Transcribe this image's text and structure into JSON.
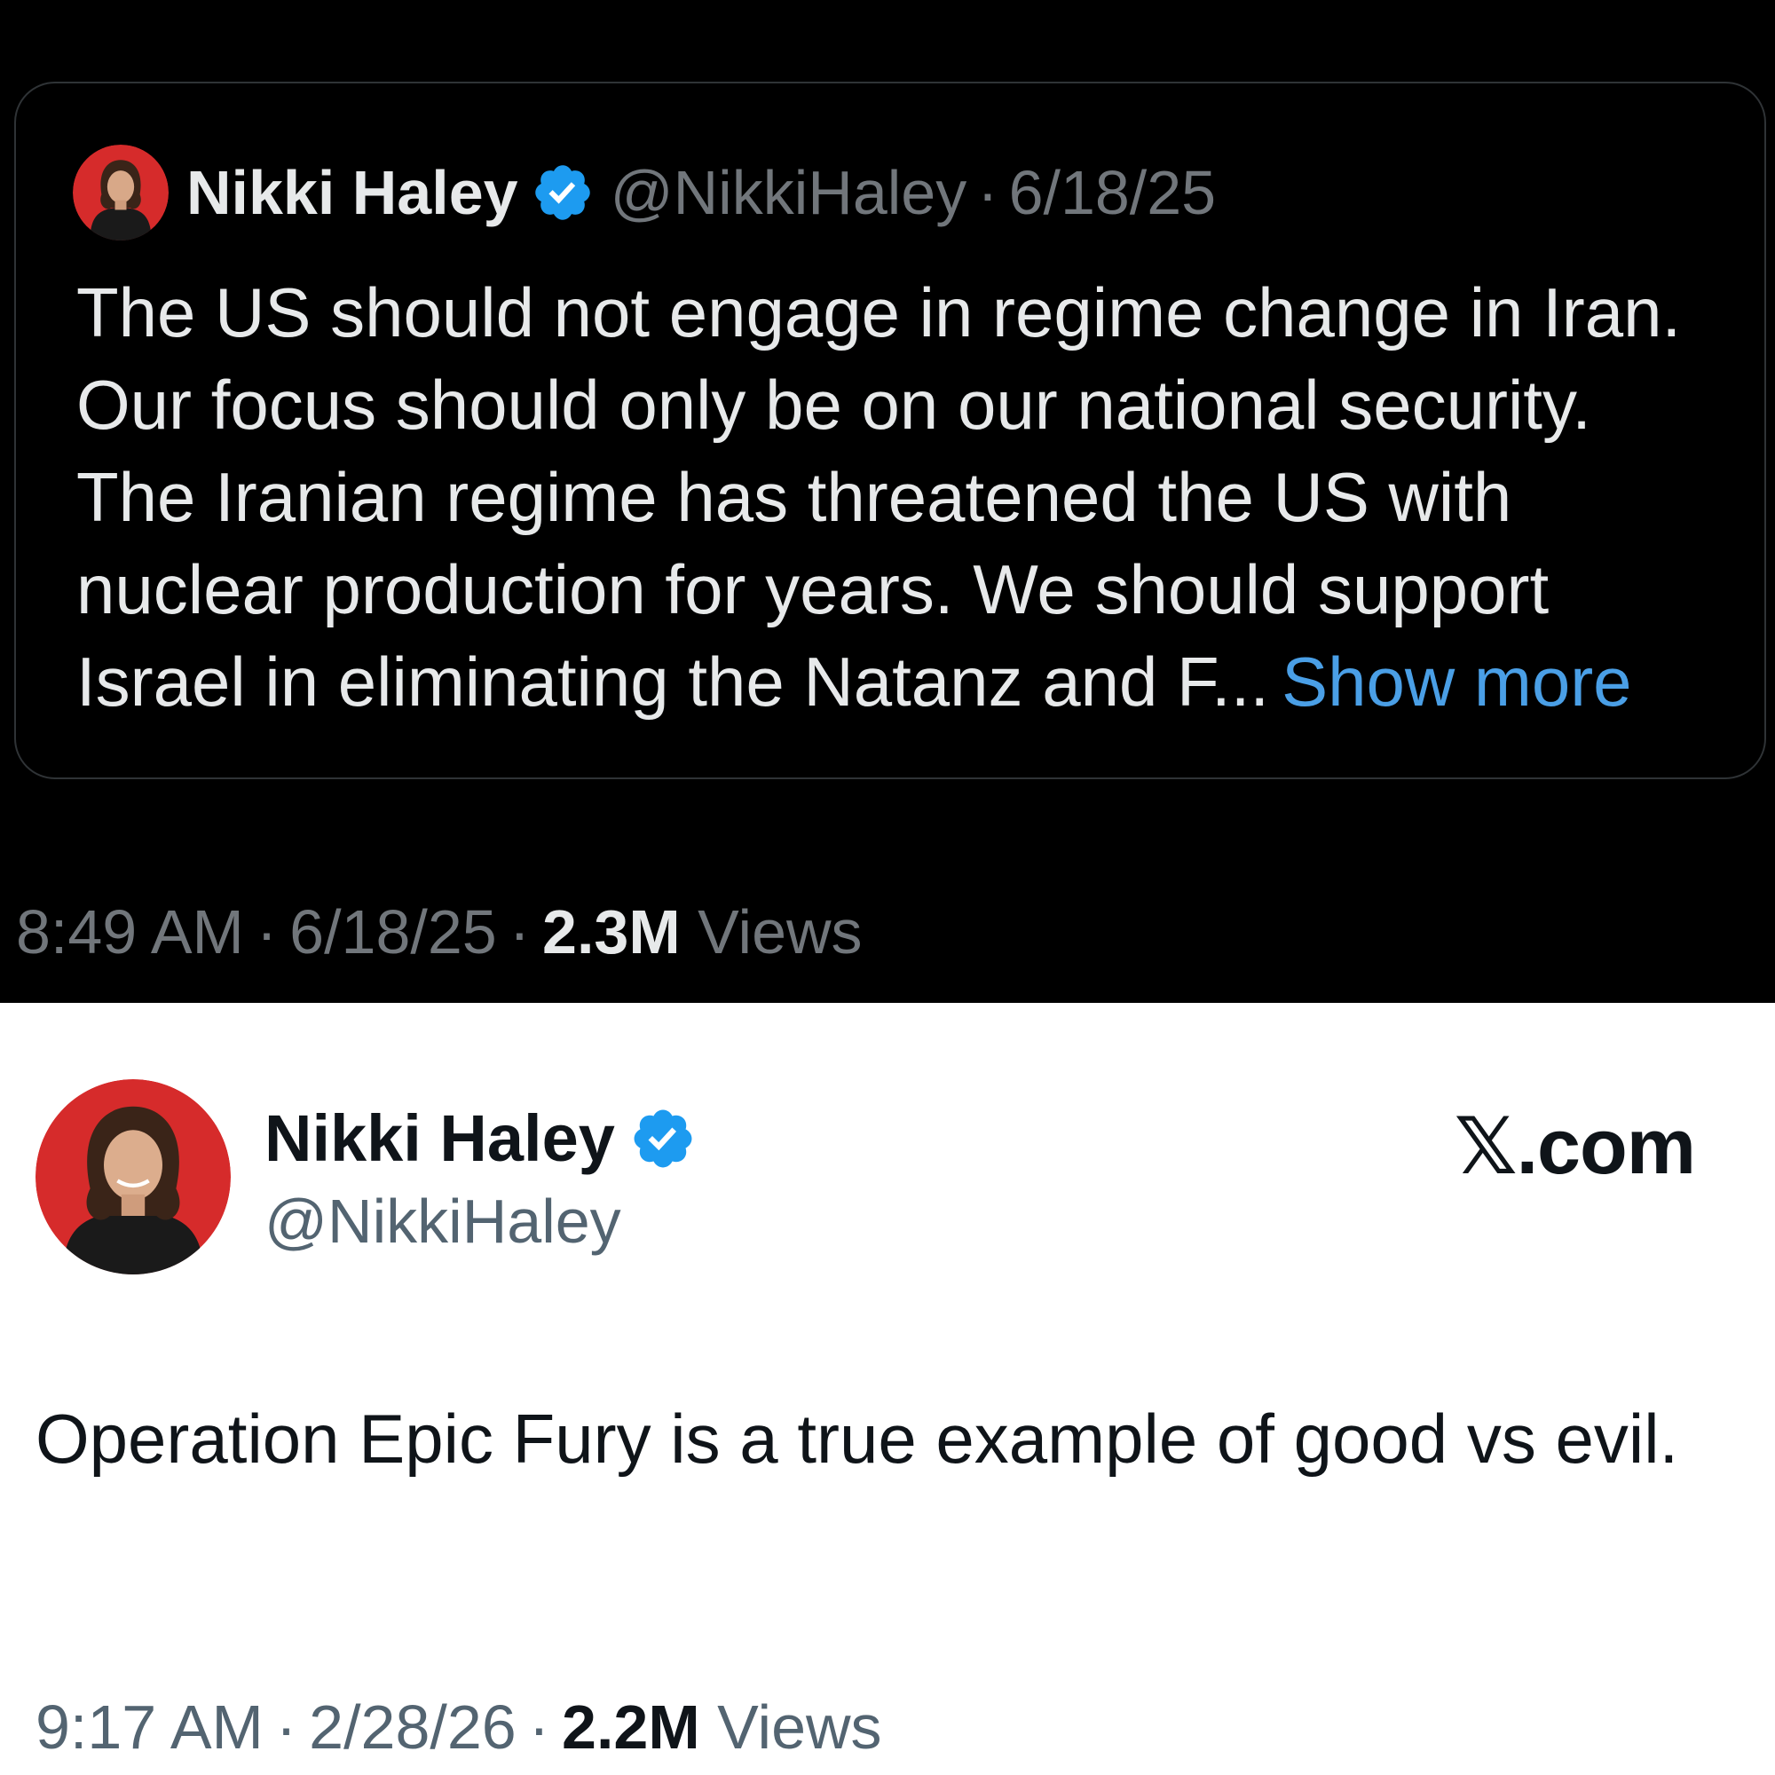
{
  "quoted_tweet": {
    "author_name": "Nikki Haley",
    "handle": "@NikkiHaley",
    "separator": "·",
    "date": "6/18/25",
    "text": "The US should not engage in regime change in Iran. Our focus should only be on our national security. The Iranian regime has threatened the US with nuclear production for years. We should support Israel in eliminating the Natanz and F...",
    "show_more_label": "Show more",
    "time": "8:49 AM",
    "full_date": "6/18/25",
    "views_count": "2.3M",
    "views_label": "Views",
    "verified_icon": "verified-badge-icon"
  },
  "main_tweet": {
    "author_name": "Nikki Haley",
    "handle": "@NikkiHaley",
    "site_label": "𝕏.com",
    "text": "Operation Epic Fury is a true example of good vs evil.",
    "time": "9:17 AM",
    "separator": "·",
    "date": "2/28/26",
    "views_count": "2.2M",
    "views_label": "Views",
    "verified_icon": "verified-badge-icon"
  },
  "colors": {
    "dark_bg": "#000000",
    "light_bg": "#ffffff",
    "link_blue": "#4a9fe6",
    "verified_blue": "#1d9bf0",
    "avatar_red": "#d62b2b"
  }
}
